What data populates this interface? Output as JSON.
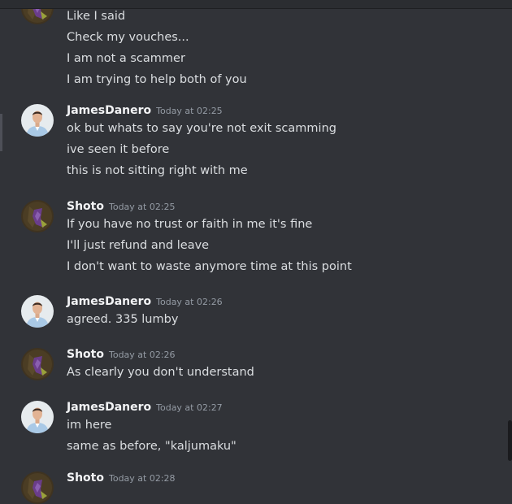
{
  "colors": {
    "background": "#313338",
    "username": "#f2f3f5",
    "timestamp": "#949ba4",
    "text": "#dbdee1"
  },
  "messages": [
    {
      "author": "",
      "timestamp": "",
      "avatar": "shoto-avatar",
      "lines": [
        "Like I said",
        "Check my vouches...",
        "I am not a scammer",
        "I am trying to help both of you"
      ]
    },
    {
      "author": "JamesDanero",
      "timestamp": "Today at 02:25",
      "avatar": "jamesdanero-avatar",
      "lines": [
        "ok but whats to say you're not exit scamming",
        "ive seen it before",
        "this is not sitting right with me"
      ]
    },
    {
      "author": "Shoto",
      "timestamp": "Today at 02:25",
      "avatar": "shoto-avatar",
      "lines": [
        "If you have no trust or faith in me it's fine",
        "I'll just refund and leave",
        "I don't want to waste anymore time at this point"
      ]
    },
    {
      "author": "JamesDanero",
      "timestamp": "Today at 02:26",
      "avatar": "jamesdanero-avatar",
      "lines": [
        "agreed. 335 lumby"
      ]
    },
    {
      "author": "Shoto",
      "timestamp": "Today at 02:26",
      "avatar": "shoto-avatar",
      "lines": [
        "As clearly you don't understand"
      ]
    },
    {
      "author": "JamesDanero",
      "timestamp": "Today at 02:27",
      "avatar": "jamesdanero-avatar",
      "lines": [
        "im here",
        "same as before, \"kaljumaku\""
      ]
    },
    {
      "author": "Shoto",
      "timestamp": "Today at 02:28",
      "avatar": "shoto-avatar",
      "lines": []
    }
  ]
}
